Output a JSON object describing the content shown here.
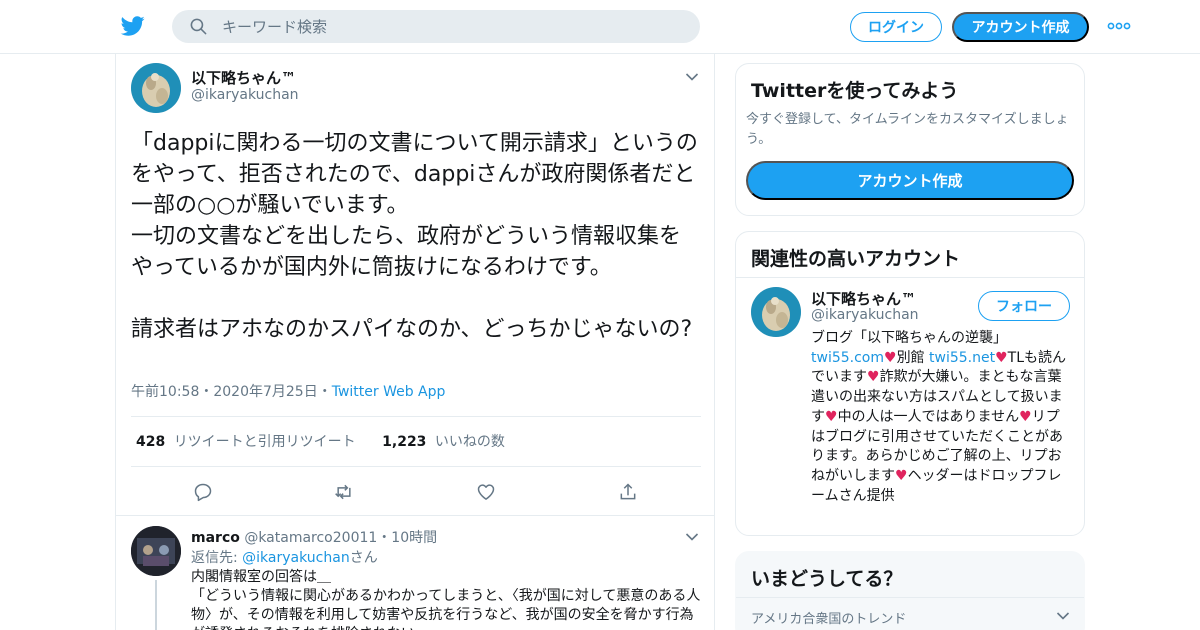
{
  "header": {
    "search_placeholder": "キーワード検索",
    "login_label": "ログイン",
    "signup_label": "アカウント作成"
  },
  "tweet": {
    "display_name": "以下略ちゃん™",
    "handle": "@ikaryakuchan",
    "text": "「dappiに関わる一切の文書について開示請求」というのをやって、拒否されたので、dappiさんが政府関係者だと一部の○○が騒いでいます。\n一切の文書などを出したら、政府がどういう情報収集をやっているかが国内外に筒抜けになるわけです。\n\n請求者はアホなのかスパイなのか、どっちかじゃないの?",
    "time": "午前10:58・2020年7月25日",
    "separator": "・",
    "app": "Twitter Web App",
    "retweet_count": "428",
    "retweet_label": "リツイートと引用リツイート",
    "like_count": "1,223",
    "like_label": "いいねの数"
  },
  "reply": {
    "display_name": "marco",
    "handle": "@katamarco20011",
    "separator": "・",
    "time": "10時間",
    "reply_to_prefix": "返信先: ",
    "reply_to_handle": "@ikaryakuchan",
    "reply_to_suffix": "さん",
    "text": "内閣情報室の回答は＿\n「どういう情報に関心があるかわかってしまうと、〈我が国に対して悪意のある人物〉が、その情報を利用して妨害や反抗を行うなど、我が国の安全を脅かす行為が誘発されるおそれを排除されない"
  },
  "sidebar": {
    "try_card": {
      "title": "Twitterを使ってみよう",
      "subtitle": "今すぐ登録して、タイムラインをカスタマイズしましょう。",
      "button_label": "アカウント作成"
    },
    "related_card": {
      "title": "関連性の高いアカウント",
      "display_name": "以下略ちゃん™",
      "handle": "@ikaryakuchan",
      "follow_label": "フォロー",
      "bio_1": "ブログ「以下略ちゃんの逆襲」",
      "bio_link_1": "twi55.com",
      "bio_2": "別館 ",
      "bio_link_2": "twi55.net",
      "bio_3": "TLも読んでいます",
      "bio_4": "詐欺が大嫌い。まともな言葉遣いの出来ない方はスパムとして扱います",
      "bio_5": "中の人は一人ではありません",
      "bio_6": "リプはブログに引用させていただくことがあります。あらかじめご了解の上、リプおねがいします",
      "bio_7": "ヘッダーはドロップフレームさん提供",
      "heart": "♥"
    },
    "trends_card": {
      "title": "いまどうしてる？",
      "location_label": "アメリカ合衆国のトレンド"
    }
  },
  "colors": {
    "accent": "#1da1f2",
    "link": "#1b95e0",
    "heart": "#e0245e",
    "secondary_text": "#657786",
    "border": "#e6ecf0"
  },
  "icons": [
    "twitter-bird-icon",
    "search-icon",
    "more-icon",
    "chevron-down-icon",
    "reply-icon",
    "retweet-icon",
    "like-icon",
    "share-icon"
  ]
}
